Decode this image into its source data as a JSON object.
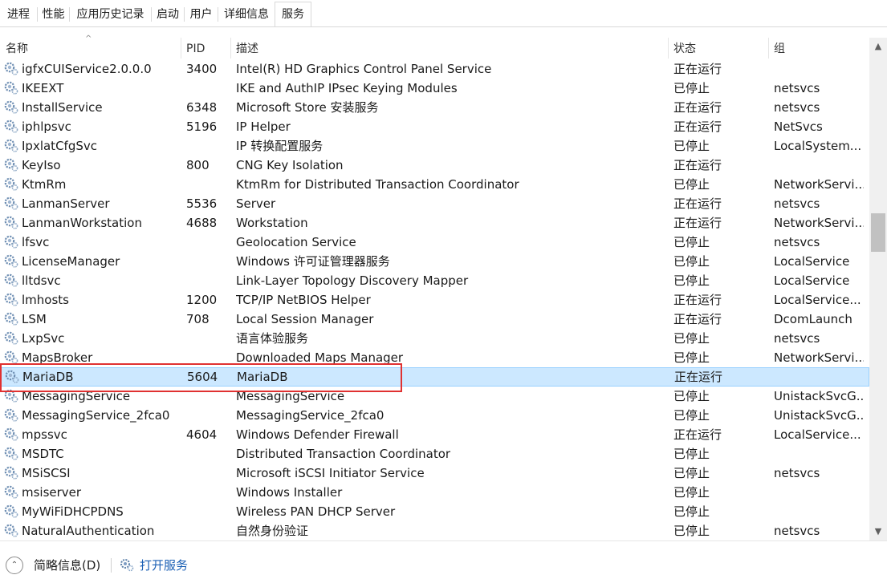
{
  "tabs": [
    {
      "label": "进程"
    },
    {
      "label": "性能"
    },
    {
      "label": "应用历史记录"
    },
    {
      "label": "启动"
    },
    {
      "label": "用户"
    },
    {
      "label": "详细信息"
    },
    {
      "label": "服务",
      "active": true
    }
  ],
  "columns": {
    "name": "名称",
    "pid": "PID",
    "desc": "描述",
    "status": "状态",
    "group": "组"
  },
  "sort_indicator": "^",
  "rows": [
    {
      "name": "igfxCUIService2.0.0.0",
      "pid": "3400",
      "desc": "Intel(R) HD Graphics Control Panel Service",
      "status": "正在运行",
      "group": ""
    },
    {
      "name": "IKEEXT",
      "pid": "",
      "desc": "IKE and AuthIP IPsec Keying Modules",
      "status": "已停止",
      "group": "netsvcs"
    },
    {
      "name": "InstallService",
      "pid": "6348",
      "desc": "Microsoft Store 安装服务",
      "status": "正在运行",
      "group": "netsvcs"
    },
    {
      "name": "iphlpsvc",
      "pid": "5196",
      "desc": "IP Helper",
      "status": "正在运行",
      "group": "NetSvcs"
    },
    {
      "name": "IpxlatCfgSvc",
      "pid": "",
      "desc": "IP 转换配置服务",
      "status": "已停止",
      "group": "LocalSystem..."
    },
    {
      "name": "KeyIso",
      "pid": "800",
      "desc": "CNG Key Isolation",
      "status": "正在运行",
      "group": ""
    },
    {
      "name": "KtmRm",
      "pid": "",
      "desc": "KtmRm for Distributed Transaction Coordinator",
      "status": "已停止",
      "group": "NetworkServi..."
    },
    {
      "name": "LanmanServer",
      "pid": "5536",
      "desc": "Server",
      "status": "正在运行",
      "group": "netsvcs"
    },
    {
      "name": "LanmanWorkstation",
      "pid": "4688",
      "desc": "Workstation",
      "status": "正在运行",
      "group": "NetworkServi..."
    },
    {
      "name": "lfsvc",
      "pid": "",
      "desc": "Geolocation Service",
      "status": "已停止",
      "group": "netsvcs"
    },
    {
      "name": "LicenseManager",
      "pid": "",
      "desc": "Windows 许可证管理器服务",
      "status": "已停止",
      "group": "LocalService"
    },
    {
      "name": "lltdsvc",
      "pid": "",
      "desc": "Link-Layer Topology Discovery Mapper",
      "status": "已停止",
      "group": "LocalService"
    },
    {
      "name": "lmhosts",
      "pid": "1200",
      "desc": "TCP/IP NetBIOS Helper",
      "status": "正在运行",
      "group": "LocalService..."
    },
    {
      "name": "LSM",
      "pid": "708",
      "desc": "Local Session Manager",
      "status": "正在运行",
      "group": "DcomLaunch"
    },
    {
      "name": "LxpSvc",
      "pid": "",
      "desc": "语言体验服务",
      "status": "已停止",
      "group": "netsvcs"
    },
    {
      "name": "MapsBroker",
      "pid": "",
      "desc": "Downloaded Maps Manager",
      "status": "已停止",
      "group": "NetworkServi..."
    },
    {
      "name": "MariaDB",
      "pid": "5604",
      "desc": "MariaDB",
      "status": "正在运行",
      "group": "",
      "selected": true
    },
    {
      "name": "MessagingService",
      "pid": "",
      "desc": "MessagingService",
      "status": "已停止",
      "group": "UnistackSvcG..."
    },
    {
      "name": "MessagingService_2fca0",
      "pid": "",
      "desc": "MessagingService_2fca0",
      "status": "已停止",
      "group": "UnistackSvcG..."
    },
    {
      "name": "mpssvc",
      "pid": "4604",
      "desc": "Windows Defender Firewall",
      "status": "正在运行",
      "group": "LocalService..."
    },
    {
      "name": "MSDTC",
      "pid": "",
      "desc": "Distributed Transaction Coordinator",
      "status": "已停止",
      "group": ""
    },
    {
      "name": "MSiSCSI",
      "pid": "",
      "desc": "Microsoft iSCSI Initiator Service",
      "status": "已停止",
      "group": "netsvcs"
    },
    {
      "name": "msiserver",
      "pid": "",
      "desc": "Windows Installer",
      "status": "已停止",
      "group": ""
    },
    {
      "name": "MyWiFiDHCPDNS",
      "pid": "",
      "desc": "Wireless PAN DHCP Server",
      "status": "已停止",
      "group": ""
    },
    {
      "name": "NaturalAuthentication",
      "pid": "",
      "desc": "自然身份验证",
      "status": "已停止",
      "group": "netsvcs"
    }
  ],
  "footer": {
    "fewer_details": "简略信息(D)",
    "open_services": "打开服务"
  },
  "colors": {
    "selection_bg": "#cce8ff",
    "selection_border": "#99d1ff",
    "annotation_box": "#e03131",
    "link": "#1a5fb4"
  },
  "icons": {
    "row": "service-gear-icon",
    "footer_toggle": "chevron-up-icon",
    "footer_link": "services-gear-icon"
  }
}
